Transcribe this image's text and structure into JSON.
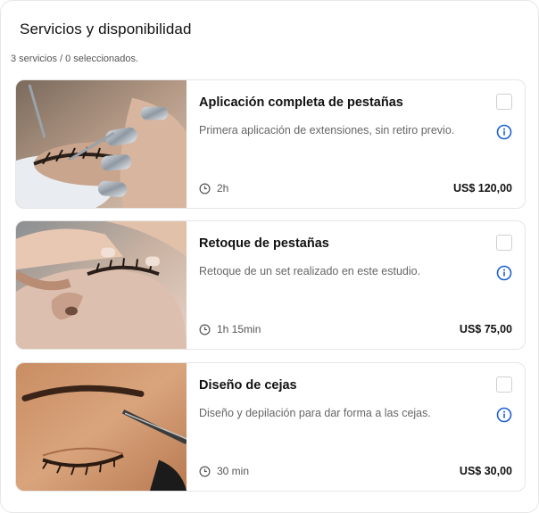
{
  "header": {
    "title": "Servicios y disponibilidad",
    "count_text": "3 servicios / 0 seleccionados."
  },
  "services": [
    {
      "name": "Aplicación completa de pestañas",
      "description": "Primera aplicación de extensiones, sin retiro previo.",
      "duration": "2h",
      "price": "US$ 120,00",
      "selected": false
    },
    {
      "name": "Retoque de pestañas",
      "description": "Retoque de un set realizado en este estudio.",
      "duration": "1h 15min",
      "price": "US$ 75,00",
      "selected": false
    },
    {
      "name": "Diseño de cejas",
      "description": "Diseño y depilación para dar forma a las cejas.",
      "duration": "30 min",
      "price": "US$ 30,00",
      "selected": false
    }
  ],
  "colors": {
    "info_accent": "#1a5fd0",
    "text_primary": "#111111",
    "text_secondary": "#666666"
  },
  "icons": {
    "info": "info-circle-icon",
    "clock": "clock-icon",
    "checkbox": "checkbox-unchecked"
  }
}
